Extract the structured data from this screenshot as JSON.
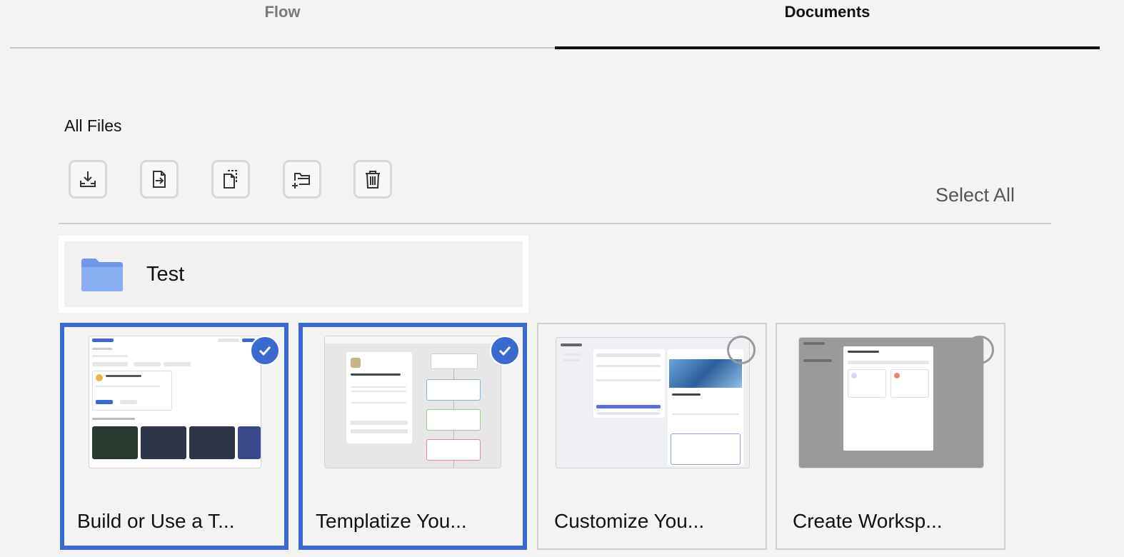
{
  "tabs": [
    {
      "label": "Flow",
      "active": false
    },
    {
      "label": "Documents",
      "active": true
    }
  ],
  "section": {
    "title": "All Files"
  },
  "toolbar": {
    "icons": [
      "download-icon",
      "export-icon",
      "copy-icon",
      "new-folder-icon",
      "trash-icon"
    ]
  },
  "select_all_label": "Select All",
  "folders": [
    {
      "name": "Test"
    }
  ],
  "documents": [
    {
      "title": "Build or Use a T...",
      "selected": true
    },
    {
      "title": "Templatize You...",
      "selected": true
    },
    {
      "title": "Customize You...",
      "selected": false
    },
    {
      "title": "Create Worksp...",
      "selected": false
    }
  ],
  "colors": {
    "accent": "#3a6ad0",
    "folder": "#7ea3ee",
    "background": "#f3f3f3"
  }
}
